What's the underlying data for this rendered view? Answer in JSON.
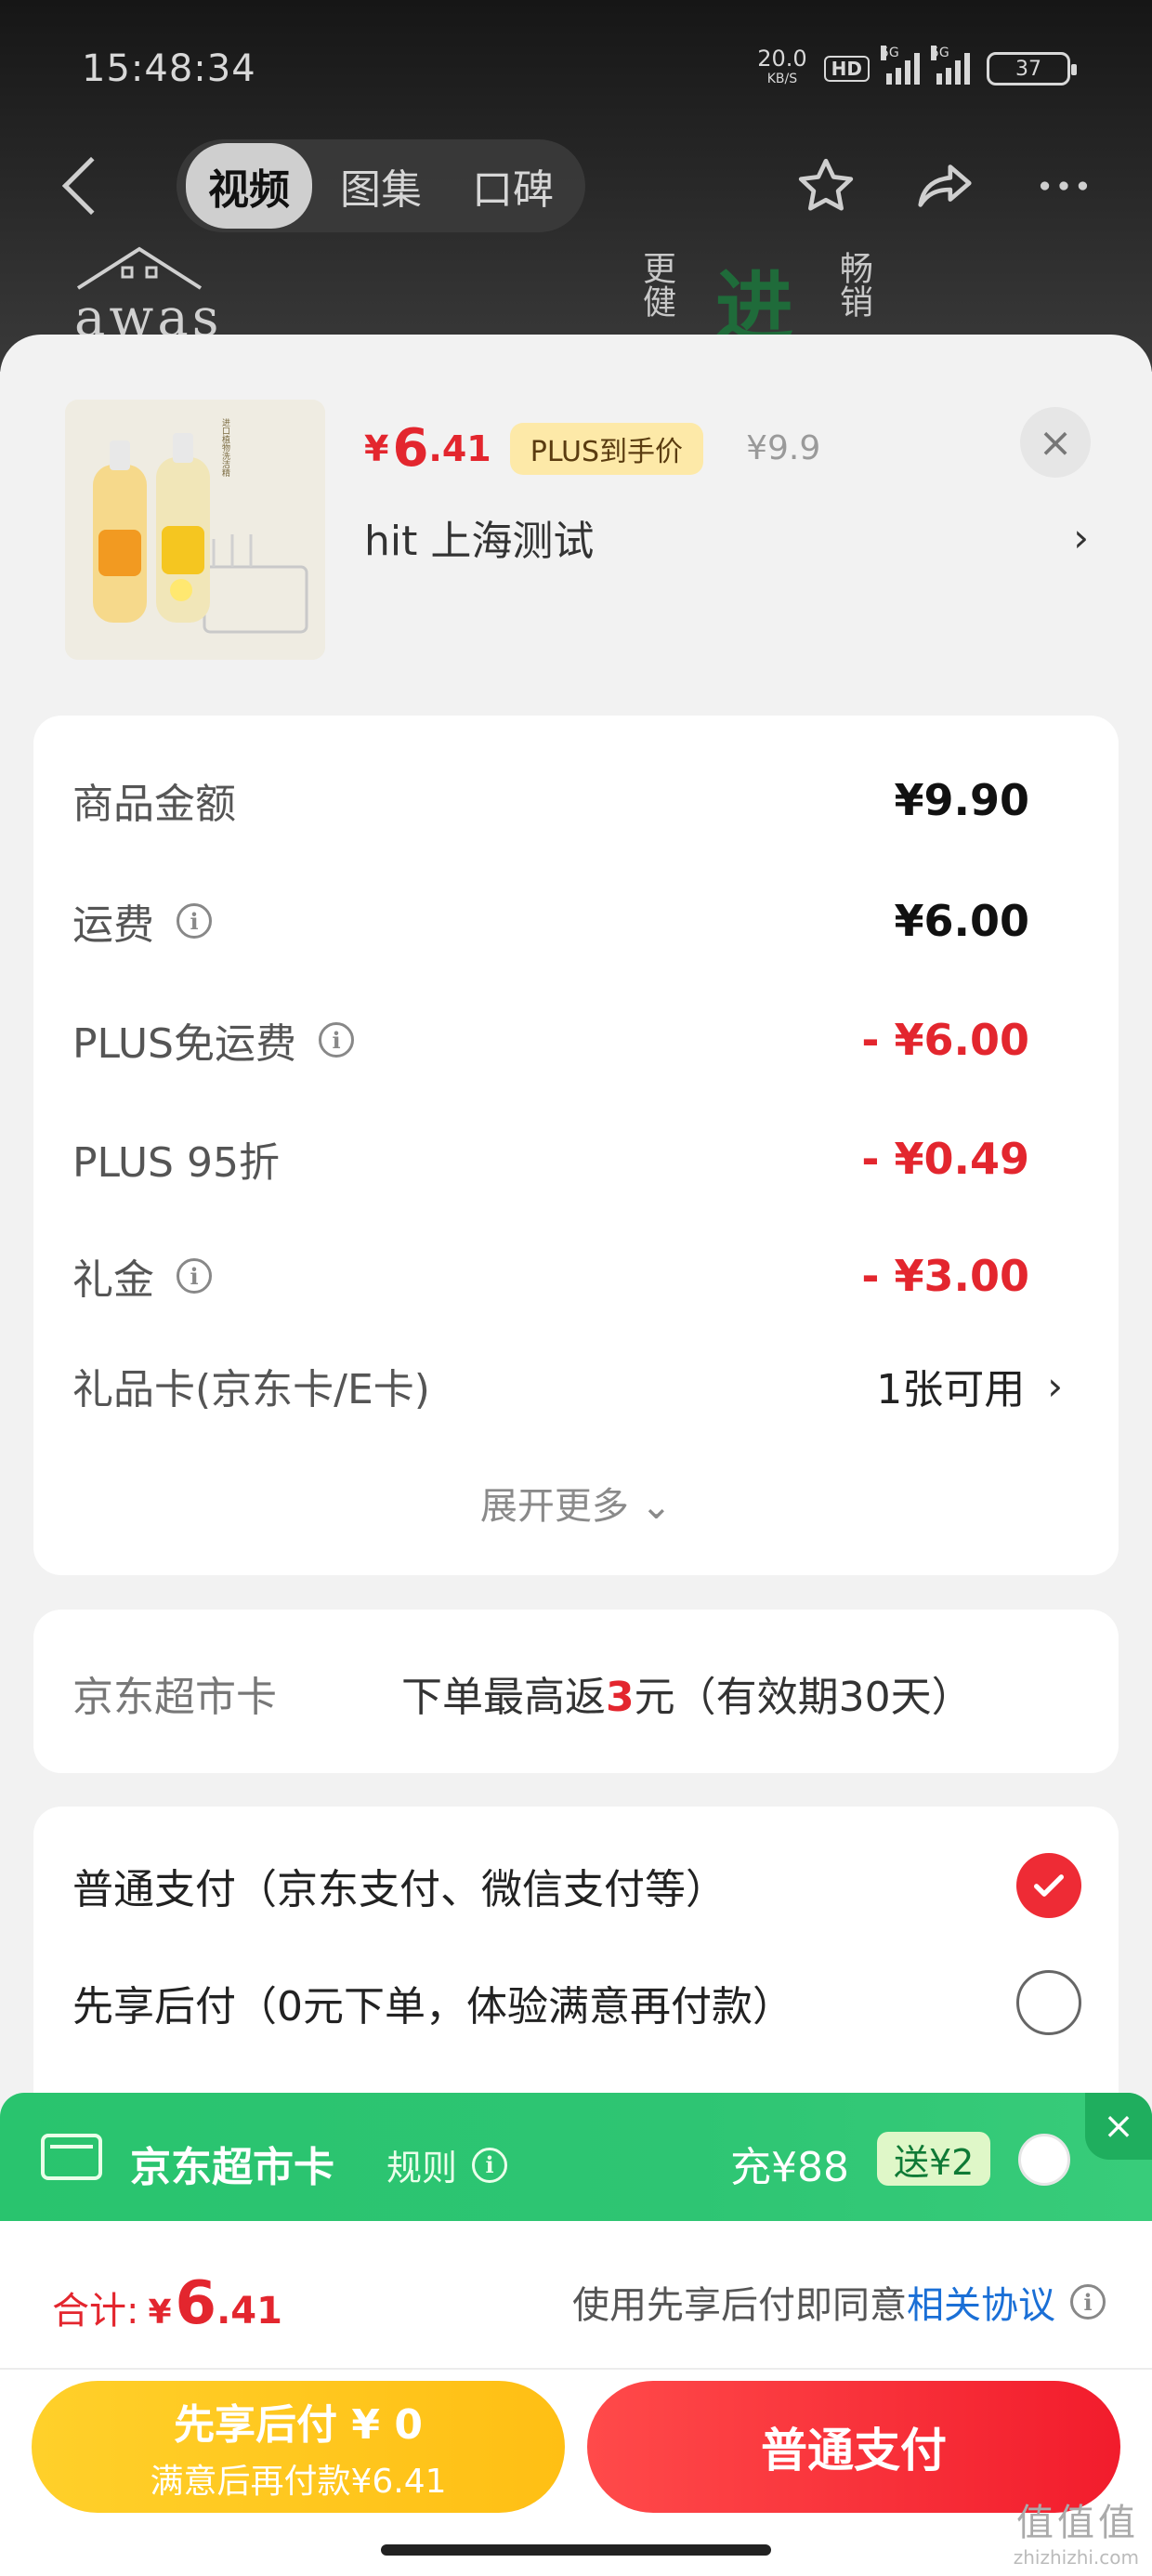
{
  "status_bar": {
    "time": "15:48:34",
    "net_speed": "20.0",
    "net_unit": "KB/S",
    "hd": "HD",
    "sim1": "5G",
    "sim2": "5G",
    "battery": "37"
  },
  "nav": {
    "tabs": [
      {
        "label": "视频",
        "active": true
      },
      {
        "label": "图集",
        "active": false
      },
      {
        "label": "口碑",
        "active": false
      }
    ]
  },
  "background": {
    "brand": "awas",
    "slogan_1": "更健",
    "slogan_2": "进",
    "slogan_3": "畅销"
  },
  "product": {
    "price_currency": "¥",
    "price_int": "6",
    "price_dec": ".41",
    "plus_tag": "PLUS到手价",
    "original_price": "¥9.9",
    "store": "hit  上海测试",
    "image_label": "进口植物洗洁精"
  },
  "fees": {
    "rows": [
      {
        "label": "商品金额",
        "value": "¥9.90"
      },
      {
        "label": "运费",
        "value": "¥6.00"
      },
      {
        "label": "PLUS免运费",
        "value": "- ¥6.00"
      },
      {
        "label": "PLUS 95折",
        "value": "- ¥0.49"
      },
      {
        "label": "礼金",
        "value": "- ¥3.00"
      },
      {
        "label": "礼品卡(京东卡/E卡)",
        "value": "1张可用"
      }
    ],
    "expand": "展开更多"
  },
  "market_card": {
    "label": "京东超市卡",
    "desc_prefix": "下单最高返",
    "desc_highlight": "3",
    "desc_suffix": "元（有效期30天）"
  },
  "payment": {
    "options": [
      {
        "label": "普通支付（京东支付、微信支付等）",
        "selected": true
      },
      {
        "label": "先享后付（0元下单，体验满意再付款）",
        "selected": false
      }
    ]
  },
  "banner": {
    "title": "京东超市卡",
    "rule": "规则",
    "charge": "充¥88",
    "gift": "送¥2",
    "close": "×"
  },
  "footer": {
    "total_label": "合计:",
    "total_currency": "¥",
    "total_int": "6",
    "total_dec": ".41",
    "agree_prefix": "使用先享后付即同意",
    "agree_link": "相关协议",
    "later_line1": "先享后付 ¥ 0",
    "later_line2": "满意后再付款¥6.41",
    "pay_label": "普通支付"
  },
  "watermark": {
    "site": "zhizhizhi.com",
    "big": "值值值"
  },
  "colors": {
    "accent_red": "#e3262e",
    "plus_gold": "#fde9a8",
    "banner_green": "#2ec573",
    "link_blue": "#1a6fd6",
    "later_yellow": "#ffc61e"
  }
}
